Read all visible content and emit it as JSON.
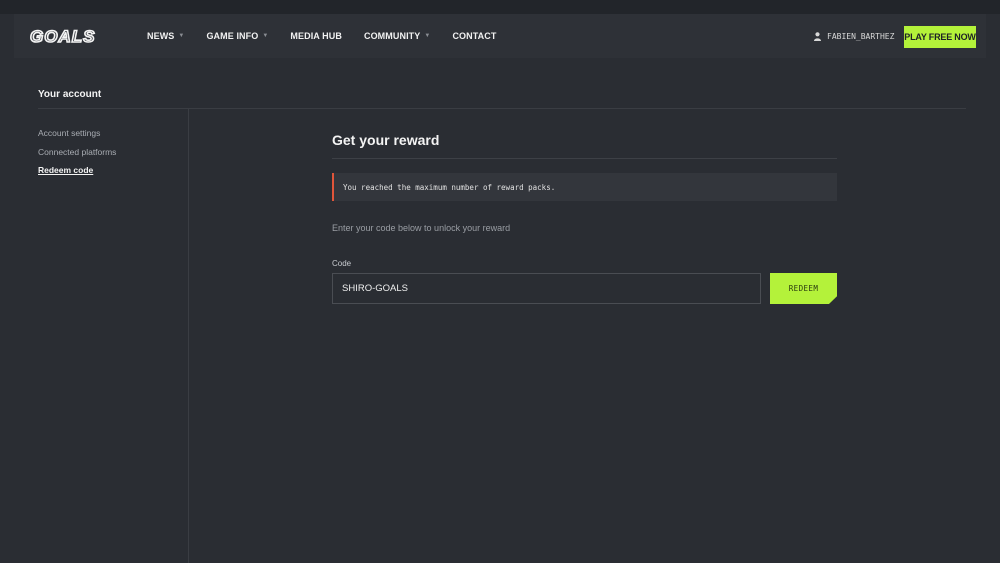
{
  "header": {
    "logo_text": "GOALS",
    "nav": [
      {
        "label": "NEWS",
        "has_dropdown": true
      },
      {
        "label": "GAME INFO",
        "has_dropdown": true
      },
      {
        "label": "MEDIA HUB",
        "has_dropdown": false
      },
      {
        "label": "COMMUNITY",
        "has_dropdown": true
      },
      {
        "label": "CONTACT",
        "has_dropdown": false
      }
    ],
    "user_icon": "user-icon",
    "username": "FABIEN_BARTHEZ",
    "play_button": "PLAY FREE NOW"
  },
  "account": {
    "title": "Your account",
    "sidebar": [
      {
        "label": "Account settings",
        "active": false
      },
      {
        "label": "Connected platforms",
        "active": false
      },
      {
        "label": "Redeem code",
        "active": true
      }
    ]
  },
  "main": {
    "title": "Get your reward",
    "alert": "You reached the maximum number of reward packs.",
    "hint": "Enter your code below to unlock your reward",
    "code_label": "Code",
    "code_value": "SHIRO-GOALS",
    "redeem_button": "REDEEM"
  },
  "colors": {
    "accent": "#b4f23a",
    "background": "#2a2d33",
    "alert_border": "#e0553a"
  }
}
